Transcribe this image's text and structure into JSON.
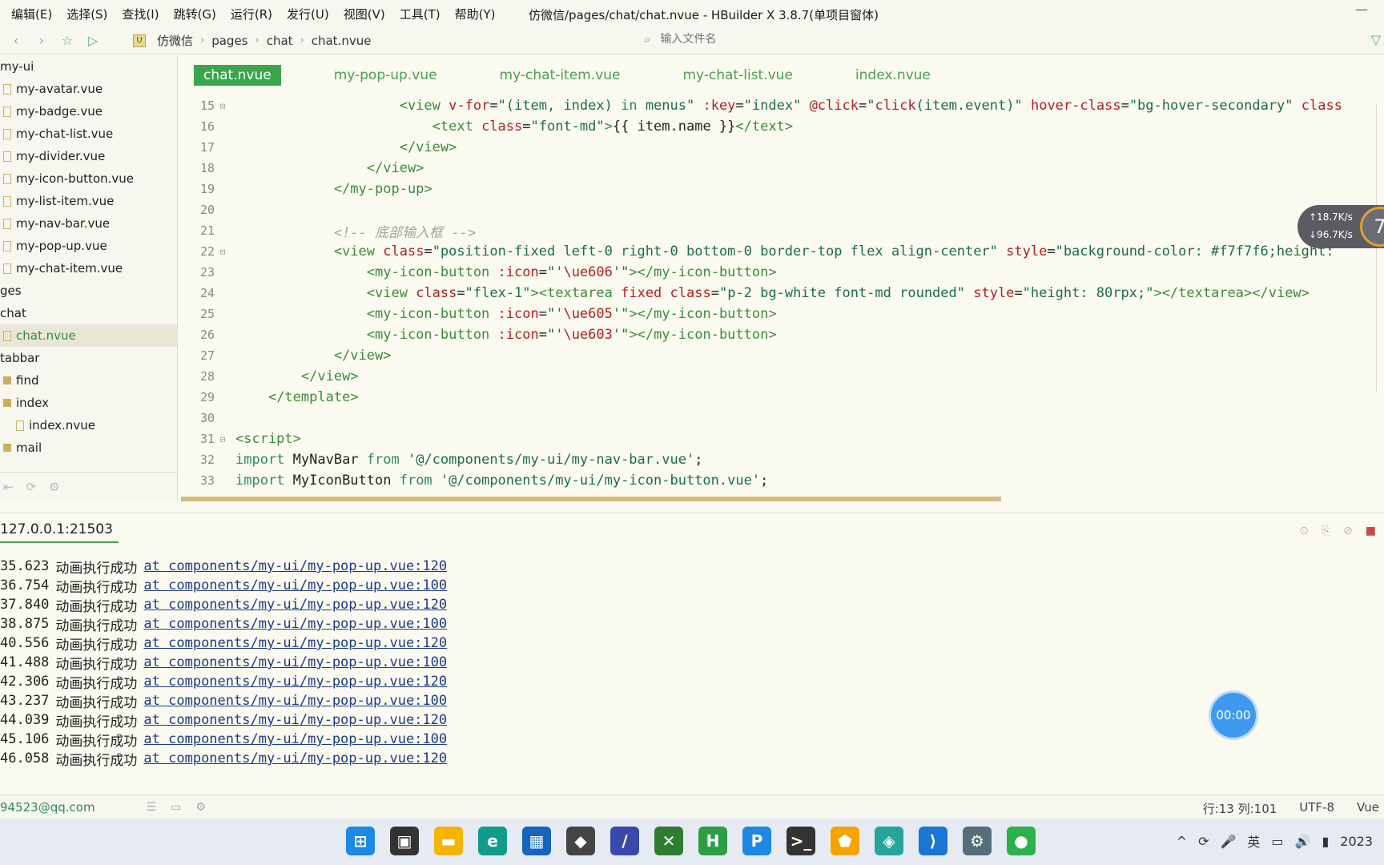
{
  "menubar": {
    "items": [
      "编辑(E)",
      "选择(S)",
      "查找(I)",
      "跳转(G)",
      "运行(R)",
      "发行(U)",
      "视图(V)",
      "工具(T)",
      "帮助(Y)"
    ],
    "window_title": "仿微信/pages/chat/chat.nvue - HBuilder X 3.8.7(单项目窗体)",
    "minimize": "—"
  },
  "toolbar": {
    "breadcrumb": [
      "仿微信",
      "pages",
      "chat",
      "chat.nvue"
    ],
    "project_badge": "U",
    "file_search_placeholder": "输入文件名"
  },
  "sidebar": {
    "items": [
      {
        "label": "my-ui",
        "kind": "folder-open",
        "indent": 0
      },
      {
        "label": "my-avatar.vue",
        "kind": "file",
        "indent": 1
      },
      {
        "label": "my-badge.vue",
        "kind": "file",
        "indent": 1
      },
      {
        "label": "my-chat-list.vue",
        "kind": "file",
        "indent": 1
      },
      {
        "label": "my-divider.vue",
        "kind": "file",
        "indent": 1
      },
      {
        "label": "my-icon-button.vue",
        "kind": "file",
        "indent": 1
      },
      {
        "label": "my-list-item.vue",
        "kind": "file",
        "indent": 1
      },
      {
        "label": "my-nav-bar.vue",
        "kind": "file",
        "indent": 1
      },
      {
        "label": "my-pop-up.vue",
        "kind": "file",
        "indent": 1
      },
      {
        "label": "my-chat-item.vue",
        "kind": "file",
        "indent": 1
      },
      {
        "label": "ges",
        "kind": "folder-open",
        "indent": 0
      },
      {
        "label": "chat",
        "kind": "folder-open",
        "indent": 0
      },
      {
        "label": "chat.nvue",
        "kind": "file",
        "indent": 1,
        "selected": true
      },
      {
        "label": "tabbar",
        "kind": "folder-open",
        "indent": 0
      },
      {
        "label": "find",
        "kind": "folder",
        "indent": 1
      },
      {
        "label": "index",
        "kind": "folder",
        "indent": 1
      },
      {
        "label": "index.nvue",
        "kind": "file",
        "indent": 2
      },
      {
        "label": "mail",
        "kind": "folder",
        "indent": 1
      }
    ]
  },
  "tabs": [
    {
      "label": "chat.nvue",
      "active": true
    },
    {
      "label": "my-pop-up.vue",
      "active": false
    },
    {
      "label": "my-chat-item.vue",
      "active": false
    },
    {
      "label": "my-chat-list.vue",
      "active": false
    },
    {
      "label": "index.nvue",
      "active": false
    }
  ],
  "code_lines": [
    {
      "n": "15",
      "fold": "⊟",
      "indent": 20,
      "tokens": [
        [
          "t",
          "<view "
        ],
        [
          "a",
          "v-for"
        ],
        [
          "x",
          "="
        ],
        [
          "s",
          "\"(item, index) "
        ],
        [
          "k",
          "in"
        ],
        [
          "s",
          " menus\" "
        ],
        [
          "a",
          ":key"
        ],
        [
          "x",
          "="
        ],
        [
          "s",
          "\"index\" "
        ],
        [
          "a",
          "@click"
        ],
        [
          "x",
          "="
        ],
        [
          "s",
          "\""
        ],
        [
          "a",
          "click"
        ],
        [
          "s",
          "(item.event)\" "
        ],
        [
          "a",
          "hover-class"
        ],
        [
          "x",
          "="
        ],
        [
          "s",
          "\"bg-hover-secondary\" "
        ],
        [
          "a",
          "class"
        ]
      ]
    },
    {
      "n": "16",
      "fold": "",
      "indent": 24,
      "tokens": [
        [
          "t",
          "<text "
        ],
        [
          "a",
          "class"
        ],
        [
          "x",
          "="
        ],
        [
          "s",
          "\"font-md\""
        ],
        [
          "t",
          ">"
        ],
        [
          "x",
          "{{ item.name }}"
        ],
        [
          "t",
          "</text>"
        ]
      ]
    },
    {
      "n": "17",
      "fold": "",
      "indent": 20,
      "tokens": [
        [
          "t",
          "</view>"
        ]
      ]
    },
    {
      "n": "18",
      "fold": "",
      "indent": 16,
      "tokens": [
        [
          "t",
          "</view>"
        ]
      ]
    },
    {
      "n": "19",
      "fold": "",
      "indent": 12,
      "tokens": [
        [
          "t",
          "</my-pop-up>"
        ]
      ]
    },
    {
      "n": "20",
      "fold": "",
      "indent": 0,
      "tokens": []
    },
    {
      "n": "21",
      "fold": "",
      "indent": 12,
      "tokens": [
        [
          "c",
          "<!-- 底部输入框 -->"
        ]
      ]
    },
    {
      "n": "22",
      "fold": "⊟",
      "indent": 12,
      "tokens": [
        [
          "t",
          "<view "
        ],
        [
          "a",
          "class"
        ],
        [
          "x",
          "="
        ],
        [
          "s",
          "\"position-fixed left-0 right-0 bottom-0 border-top flex align-center\" "
        ],
        [
          "a",
          "style"
        ],
        [
          "x",
          "="
        ],
        [
          "s",
          "\"background-color: #f7f7f6;height:"
        ]
      ]
    },
    {
      "n": "23",
      "fold": "",
      "indent": 16,
      "tokens": [
        [
          "t",
          "<my-icon-button "
        ],
        [
          "a",
          ":icon"
        ],
        [
          "x",
          "="
        ],
        [
          "s",
          "\"'"
        ],
        [
          "a",
          "\\ue606"
        ],
        [
          "s",
          "'\""
        ],
        [
          "t",
          "></my-icon-button>"
        ]
      ]
    },
    {
      "n": "24",
      "fold": "",
      "indent": 16,
      "tokens": [
        [
          "t",
          "<view "
        ],
        [
          "a",
          "class"
        ],
        [
          "x",
          "="
        ],
        [
          "s",
          "\"flex-1\""
        ],
        [
          "t",
          "><textarea "
        ],
        [
          "a",
          "fixed class"
        ],
        [
          "x",
          "="
        ],
        [
          "s",
          "\"p-2 bg-white font-md rounded\" "
        ],
        [
          "a",
          "style"
        ],
        [
          "x",
          "="
        ],
        [
          "s",
          "\"height: 80rpx;\""
        ],
        [
          "t",
          "></textarea></view>"
        ]
      ]
    },
    {
      "n": "25",
      "fold": "",
      "indent": 16,
      "tokens": [
        [
          "t",
          "<my-icon-button "
        ],
        [
          "a",
          ":icon"
        ],
        [
          "x",
          "="
        ],
        [
          "s",
          "\"'"
        ],
        [
          "a",
          "\\ue605"
        ],
        [
          "s",
          "'\""
        ],
        [
          "t",
          "></my-icon-button>"
        ]
      ]
    },
    {
      "n": "26",
      "fold": "",
      "indent": 16,
      "tokens": [
        [
          "t",
          "<my-icon-button "
        ],
        [
          "a",
          ":icon"
        ],
        [
          "x",
          "="
        ],
        [
          "s",
          "\"'"
        ],
        [
          "a",
          "\\ue603"
        ],
        [
          "s",
          "'\""
        ],
        [
          "t",
          "></my-icon-button>"
        ]
      ]
    },
    {
      "n": "27",
      "fold": "",
      "indent": 12,
      "tokens": [
        [
          "t",
          "</view>"
        ]
      ]
    },
    {
      "n": "28",
      "fold": "",
      "indent": 8,
      "tokens": [
        [
          "t",
          "</view>"
        ]
      ]
    },
    {
      "n": "29",
      "fold": "",
      "indent": 4,
      "tokens": [
        [
          "t",
          "</template>"
        ]
      ]
    },
    {
      "n": "30",
      "fold": "",
      "indent": 0,
      "tokens": []
    },
    {
      "n": "31",
      "fold": "⊟",
      "indent": 0,
      "tokens": [
        [
          "t",
          "<script>"
        ]
      ]
    },
    {
      "n": "32",
      "fold": "",
      "indent": 0,
      "tokens": [
        [
          "k",
          "import"
        ],
        [
          "x",
          " MyNavBar "
        ],
        [
          "k",
          "from"
        ],
        [
          "s",
          " '@/components/my-ui/my-nav-bar.vue'"
        ],
        [
          "x",
          ";"
        ]
      ]
    },
    {
      "n": "33",
      "fold": "",
      "indent": 0,
      "tokens": [
        [
          "k",
          "import"
        ],
        [
          "x",
          " MyIconButton "
        ],
        [
          "k",
          "from"
        ],
        [
          "s",
          " '@/components/my-ui/my-icon-button.vue'"
        ],
        [
          "x",
          ";"
        ]
      ]
    }
  ],
  "net_widget": {
    "up": "↑18.7K/s",
    "down": "↓96.7K/s",
    "badge": "7"
  },
  "console": {
    "tab_label": "127.0.0.1:21503",
    "lines": [
      {
        "time": "35.623",
        "msg": "动画执行成功",
        "link": "at components/my-ui/my-pop-up.vue:120"
      },
      {
        "time": "36.754",
        "msg": "动画执行成功",
        "link": "at components/my-ui/my-pop-up.vue:100"
      },
      {
        "time": "37.840",
        "msg": "动画执行成功",
        "link": "at components/my-ui/my-pop-up.vue:120"
      },
      {
        "time": "38.875",
        "msg": "动画执行成功",
        "link": "at components/my-ui/my-pop-up.vue:100"
      },
      {
        "time": "40.556",
        "msg": "动画执行成功",
        "link": "at components/my-ui/my-pop-up.vue:120"
      },
      {
        "time": "41.488",
        "msg": "动画执行成功",
        "link": "at components/my-ui/my-pop-up.vue:100"
      },
      {
        "time": "42.306",
        "msg": "动画执行成功",
        "link": "at components/my-ui/my-pop-up.vue:120"
      },
      {
        "time": "43.237",
        "msg": "动画执行成功",
        "link": "at components/my-ui/my-pop-up.vue:100"
      },
      {
        "time": "44.039",
        "msg": "动画执行成功",
        "link": "at components/my-ui/my-pop-up.vue:120"
      },
      {
        "time": "45.106",
        "msg": "动画执行成功",
        "link": "at components/my-ui/my-pop-up.vue:100"
      },
      {
        "time": "46.058",
        "msg": "动画执行成功",
        "link": "at components/my-ui/my-pop-up.vue:120"
      }
    ]
  },
  "timer": "00:00",
  "statusbar": {
    "user": "94523@qq.com",
    "position": "行:13  列:101",
    "encoding": "UTF-8",
    "language": "Vue"
  },
  "taskbar": {
    "apps": [
      {
        "name": "windows-start-icon",
        "glyph": "⊞",
        "color": "#1e88e5"
      },
      {
        "name": "task-view-icon",
        "glyph": "▣",
        "color": "#333333"
      },
      {
        "name": "file-explorer-icon",
        "glyph": "▬",
        "color": "#f4b400"
      },
      {
        "name": "edge-icon",
        "glyph": "e",
        "color": "#0f9d8a"
      },
      {
        "name": "store-icon",
        "glyph": "▦",
        "color": "#1565c0"
      },
      {
        "name": "unity-icon",
        "glyph": "◆",
        "color": "#444444"
      },
      {
        "name": "writer-icon",
        "glyph": "∕",
        "color": "#3949ab"
      },
      {
        "name": "xbox-icon",
        "glyph": "✕",
        "color": "#2e7d32"
      },
      {
        "name": "hbuilder-icon",
        "glyph": "H",
        "color": "#2e9e44"
      },
      {
        "name": "pycharm-icon",
        "glyph": "P",
        "color": "#1e88e5"
      },
      {
        "name": "terminal-icon",
        "glyph": ">_",
        "color": "#333333"
      },
      {
        "name": "app-gem-icon",
        "glyph": "⬟",
        "color": "#f4a300"
      },
      {
        "name": "app-prism-icon",
        "glyph": "◈",
        "color": "#26a69a"
      },
      {
        "name": "vscode-icon",
        "glyph": "⟩",
        "color": "#1976d2"
      },
      {
        "name": "settings-icon",
        "glyph": "⚙",
        "color": "#546e7a"
      },
      {
        "name": "wechat-icon",
        "glyph": "●",
        "color": "#2bb24c"
      }
    ],
    "tray": [
      "^",
      "⟳",
      "🎤",
      "英",
      "▭",
      "🔊",
      "▮"
    ],
    "clock": "2023"
  }
}
